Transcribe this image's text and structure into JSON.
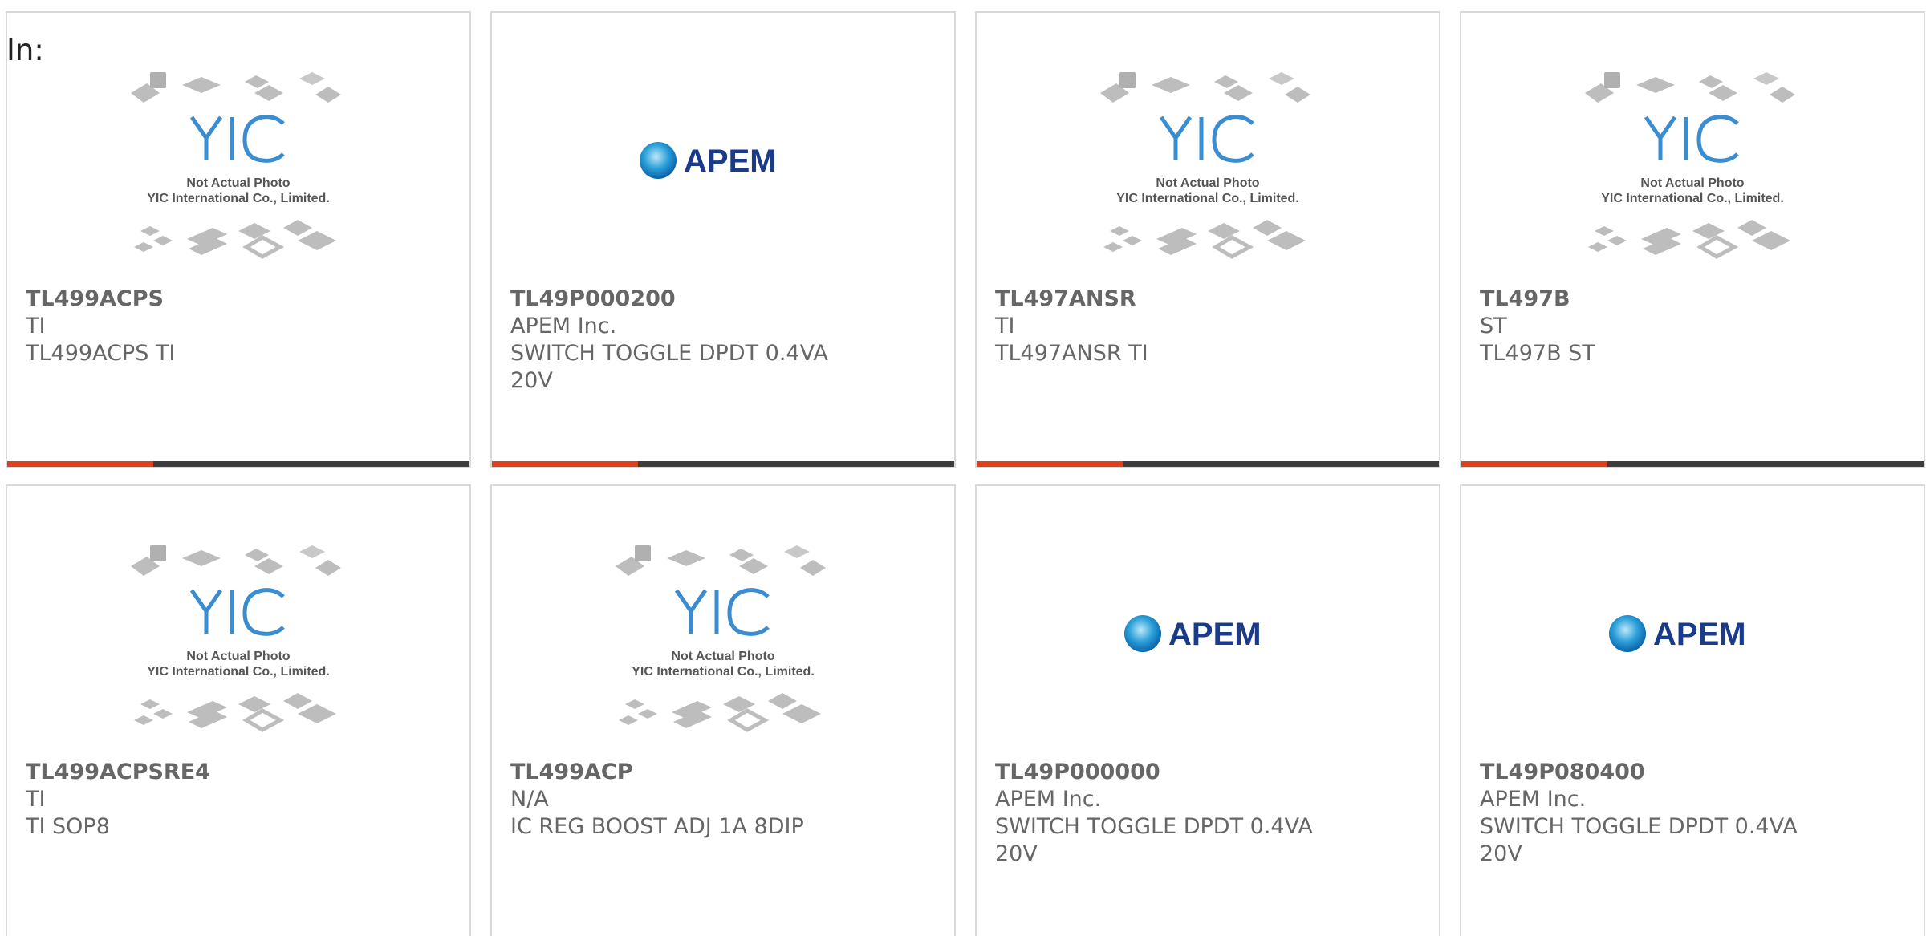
{
  "header": {
    "in_label": "In:"
  },
  "images": {
    "yic_caption_line1": "Not Actual Photo",
    "yic_caption_line2": "YIC International Co., Limited.",
    "apem_logo_text": "APEM"
  },
  "colors": {
    "accent": "#e2401b",
    "bar": "#3d3d3d",
    "yic_blue": "#3a8dd1",
    "apem_navy": "#1a3a8a",
    "apem_cyan": "#2a9fd8",
    "text": "#666666"
  },
  "products": [
    {
      "part": "TL499ACPS",
      "maker": "TI",
      "desc": "TL499ACPS TI",
      "image": "yic-placeholder"
    },
    {
      "part": "TL49P000200",
      "maker": "APEM Inc.",
      "desc": "SWITCH TOGGLE DPDT 0.4VA 20V",
      "image": "apem-logo"
    },
    {
      "part": "TL497ANSR",
      "maker": "TI",
      "desc": "TL497ANSR TI",
      "image": "yic-placeholder"
    },
    {
      "part": "TL497B",
      "maker": "ST",
      "desc": "TL497B ST",
      "image": "yic-placeholder"
    },
    {
      "part": "TL499ACPSRE4",
      "maker": "TI",
      "desc": "TI SOP8",
      "image": "yic-placeholder"
    },
    {
      "part": "TL499ACP",
      "maker": "N/A",
      "desc": "IC REG BOOST ADJ 1A 8DIP",
      "image": "yic-placeholder"
    },
    {
      "part": "TL49P000000",
      "maker": "APEM Inc.",
      "desc": "SWITCH TOGGLE DPDT 0.4VA 20V",
      "image": "apem-logo"
    },
    {
      "part": "TL49P080400",
      "maker": "APEM Inc.",
      "desc": "SWITCH TOGGLE DPDT 0.4VA 20V",
      "image": "apem-logo"
    }
  ]
}
